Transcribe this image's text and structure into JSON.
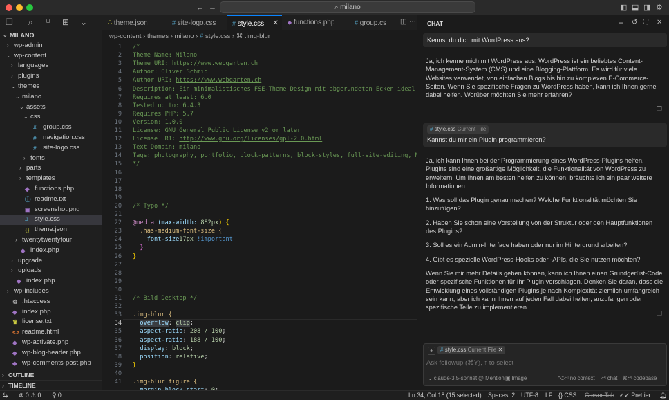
{
  "window": {
    "search": "milano"
  },
  "explorer": {
    "root": "MILANO",
    "items": [
      {
        "label": "wp-admin",
        "depth": 1,
        "kind": "folder",
        "open": false
      },
      {
        "label": "wp-content",
        "depth": 1,
        "kind": "folder",
        "open": true
      },
      {
        "label": "languages",
        "depth": 2,
        "kind": "folder",
        "open": false
      },
      {
        "label": "plugins",
        "depth": 2,
        "kind": "folder",
        "open": false
      },
      {
        "label": "themes",
        "depth": 2,
        "kind": "folder",
        "open": true
      },
      {
        "label": "milano",
        "depth": 3,
        "kind": "folder",
        "open": true
      },
      {
        "label": "assets",
        "depth": 4,
        "kind": "folder",
        "open": true
      },
      {
        "label": "css",
        "depth": 5,
        "kind": "folder",
        "open": true
      },
      {
        "label": "group.css",
        "depth": 6,
        "kind": "css"
      },
      {
        "label": "navigation.css",
        "depth": 6,
        "kind": "css"
      },
      {
        "label": "site-logo.css",
        "depth": 6,
        "kind": "css"
      },
      {
        "label": "fonts",
        "depth": 5,
        "kind": "folder",
        "open": false
      },
      {
        "label": "parts",
        "depth": 4,
        "kind": "folder",
        "open": false
      },
      {
        "label": "templates",
        "depth": 4,
        "kind": "folder",
        "open": false
      },
      {
        "label": "functions.php",
        "depth": 4,
        "kind": "php"
      },
      {
        "label": "readme.txt",
        "depth": 4,
        "kind": "info"
      },
      {
        "label": "screenshot.png",
        "depth": 4,
        "kind": "image"
      },
      {
        "label": "style.css",
        "depth": 4,
        "kind": "css",
        "selected": true
      },
      {
        "label": "theme.json",
        "depth": 4,
        "kind": "json"
      },
      {
        "label": "twentytwentyfour",
        "depth": 3,
        "kind": "folder",
        "open": false
      },
      {
        "label": "index.php",
        "depth": 3,
        "kind": "php"
      },
      {
        "label": "upgrade",
        "depth": 2,
        "kind": "folder",
        "open": false
      },
      {
        "label": "uploads",
        "depth": 2,
        "kind": "folder",
        "open": false
      },
      {
        "label": "index.php",
        "depth": 2,
        "kind": "php"
      },
      {
        "label": "wp-includes",
        "depth": 1,
        "kind": "folder",
        "open": false
      },
      {
        "label": ".htaccess",
        "depth": 1,
        "kind": "gear"
      },
      {
        "label": "index.php",
        "depth": 1,
        "kind": "php"
      },
      {
        "label": "license.txt",
        "depth": 1,
        "kind": "license"
      },
      {
        "label": "readme.html",
        "depth": 1,
        "kind": "html"
      },
      {
        "label": "wp-activate.php",
        "depth": 1,
        "kind": "php"
      },
      {
        "label": "wp-blog-header.php",
        "depth": 1,
        "kind": "php"
      },
      {
        "label": "wp-comments-post.php",
        "depth": 1,
        "kind": "php"
      }
    ],
    "outline": "OUTLINE",
    "timeline": "TIMELINE"
  },
  "tabs": [
    {
      "label": "theme.json",
      "icon": "{}"
    },
    {
      "label": "site-logo.css",
      "icon": "#"
    },
    {
      "label": "style.css",
      "icon": "#",
      "active": true
    },
    {
      "label": "functions.php",
      "icon": "php"
    },
    {
      "label": "group.cs",
      "icon": "#"
    }
  ],
  "breadcrumb": [
    "wp-content",
    "themes",
    "milano",
    "style.css",
    ".img-blur"
  ],
  "code": {
    "line_numbers": [
      "1",
      "2",
      "3",
      "4",
      "5",
      "6",
      "7",
      "8",
      "9",
      "10",
      "11",
      "12",
      "13",
      "14",
      "15",
      "16",
      "17",
      "18",
      "19",
      "20",
      "21",
      "22",
      "23",
      "24",
      "25",
      "26",
      "27",
      "28",
      "29",
      "30",
      "31",
      "32",
      "33",
      "34",
      "35",
      "36",
      "37",
      "38",
      "39",
      "40",
      "41"
    ],
    "header_comment": [
      "/*",
      "Theme Name: Milano",
      "Theme URI: ",
      "Author: Oliver Schmid",
      "Author URI: ",
      "Description: Ein minimalistisches FSE-Theme Design mit abgerundeten Ecken ideal für M",
      "Requires at least: 6.0",
      "Tested up to: 6.4.3",
      "Requires PHP: 5.7",
      "Version: 1.0.0",
      "License: GNU General Public License v2 or later",
      "License URI: ",
      "Text Domain: milano",
      "Tags: photography, portfolio, block-patterns, block-styles, full-site-editing, Mode,",
      "*/"
    ],
    "theme_uri": "https://www.webgarten.ch",
    "author_uri": "https://www.webgarten.ch",
    "license_uri": "http://www.gnu.org/licenses/gpl-2.0.html",
    "typo_comment": "/* Typo */",
    "media_kw": "@media",
    "media_query": " (max-width: ",
    "media_value": "882px",
    "media_close": ") {",
    "medium_selector": "  .has-medium-font-size {",
    "font_size_prop": "    font-size",
    "font_size_value": "17px",
    "important": " !important",
    "close_inner": "  }",
    "close_outer": "}",
    "bild_comment": "/* Bild Desktop */",
    "img_blur_selector": ".img-blur {",
    "props": [
      {
        "name": "overflow",
        "value": "clip"
      },
      {
        "name": "aspect-ratio",
        "value": "208 / 100"
      },
      {
        "name": "aspect-ratio",
        "value": "188 / 100"
      },
      {
        "name": "display",
        "value": "block"
      },
      {
        "name": "position",
        "value": "relative"
      }
    ],
    "close_block": "}",
    "figure_selector": ".img-blur figure {",
    "margin_prop": "  margin-block-start",
    "margin_value": "0"
  },
  "chat": {
    "title": "CHAT",
    "q1": "Kennst du dich mit WordPress aus?",
    "a1": "Ja, ich kenne mich mit WordPress aus. WordPress ist ein beliebtes Content-Management-System (CMS) und eine Blogging-Plattform. Es wird für viele Websites verwendet, von einfachen Blogs bis hin zu komplexen E-Commerce-Seiten. Wenn Sie spezifische Fragen zu WordPress haben, kann ich Ihnen gerne dabei helfen. Worüber möchten Sie mehr erfahren?",
    "q2_chip_file": "style.css",
    "q2_chip_label": "Current File",
    "q2": "Kannst du mir ein Plugin programmieren?",
    "a2_intro": "Ja, ich kann Ihnen bei der Programmierung eines WordPress-Plugins helfen. Plugins sind eine großartige Möglichkeit, die Funktionalität von WordPress zu erweitern. Um Ihnen am besten helfen zu können, bräuchte ich ein paar weitere Informationen:",
    "a2_points": [
      "1. Was soll das Plugin genau machen? Welche Funktionalität möchten Sie hinzufügen?",
      "2. Haben Sie schon eine Vorstellung von der Struktur oder den Hauptfunktionen des Plugins?",
      "3. Soll es ein Admin-Interface haben oder nur im Hintergrund arbeiten?",
      "4. Gibt es spezielle WordPress-Hooks oder -APIs, die Sie nutzen möchten?"
    ],
    "a2_outro": "Wenn Sie mir mehr Details geben können, kann ich Ihnen einen Grundgerüst-Code oder spezifische Funktionen für Ihr Plugin vorschlagen. Denken Sie daran, dass die Entwicklung eines vollständigen Plugins je nach Komplexität ziemlich umfangreich sein kann, aber ich kann Ihnen auf jeden Fall dabei helfen, anzufangen oder spezifische Teile zu implementieren.",
    "input_chip_file": "style.css",
    "input_chip_label": "Current File",
    "input_placeholder": "Ask followup (⌘Y), ↑ to select",
    "model": "claude-3.5-sonnet",
    "mention": "Mention",
    "image": "Image",
    "no_context": "no context",
    "chat_btn": "chat",
    "codebase": "codebase"
  },
  "status": {
    "errors": "0",
    "warnings": "0",
    "ports": "0",
    "position": "Ln 34, Col 18 (15 selected)",
    "spaces": "Spaces: 2",
    "encoding": "UTF-8",
    "eol": "LF",
    "language": "CSS",
    "cursor_tab": "Cursor Tab",
    "prettier": "Prettier"
  },
  "colors": {
    "accent": "#0a84ff",
    "folder": "#cccccc",
    "css": "#519aba",
    "php": "#a074c4",
    "json": "#cbcb41",
    "info": "#519aba"
  }
}
